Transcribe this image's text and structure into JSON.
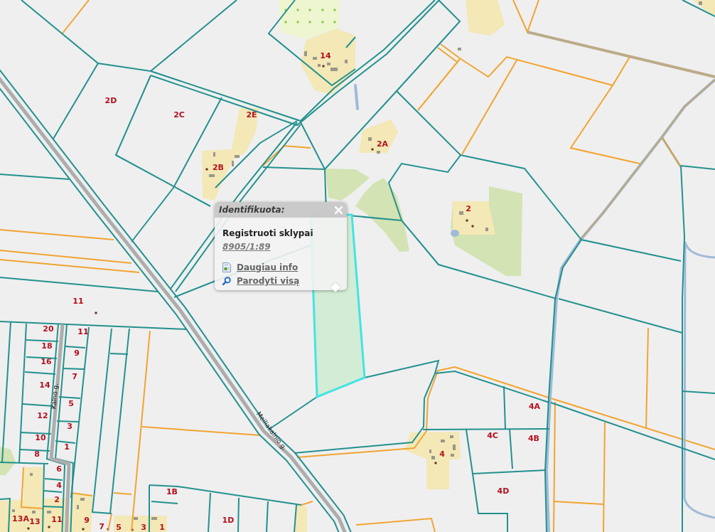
{
  "map": {
    "parcel_numbers": [
      "14",
      "2D",
      "2C",
      "2E",
      "2A",
      "2B",
      "2",
      "11",
      "20",
      "11",
      "18",
      "9",
      "16",
      "7",
      "14",
      "5",
      "4A",
      "12",
      "3",
      "10",
      "4C",
      "4B",
      "1",
      "8",
      "4",
      "6",
      "4",
      "1B",
      "4D",
      "2",
      "13A",
      "13",
      "11",
      "9",
      "7",
      "5",
      "3",
      "1",
      "1D"
    ],
    "street_names": [
      "Meiliakalnio g.",
      "Kalno g."
    ]
  },
  "popup": {
    "title": "Identifikuota:",
    "layer": "Registruoti sklypai",
    "parcel_id": "8905/1:89",
    "links": [
      {
        "kind": "info",
        "label": "Daugiau info"
      },
      {
        "kind": "zoom",
        "label": "Parodyti visą"
      }
    ]
  }
}
